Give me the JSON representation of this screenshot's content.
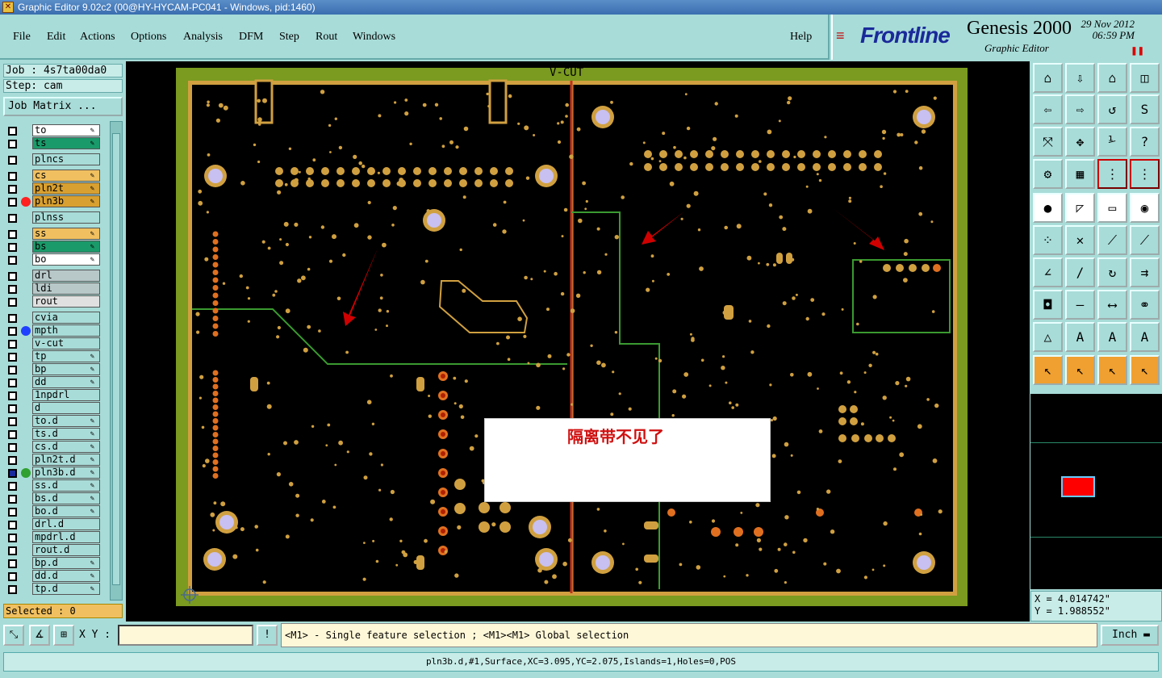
{
  "window": {
    "title": "Graphic Editor 9.02c2 (00@HY-HYCAM-PC041 - Windows, pid:1460)"
  },
  "menu": [
    "File",
    "Edit",
    "Actions",
    "Options",
    "Analysis",
    "DFM",
    "Step",
    "Rout",
    "Windows"
  ],
  "help": "Help",
  "brand": {
    "logo": "Frontline",
    "product": "Genesis 2000",
    "subtitle": "Graphic Editor",
    "date": "29 Nov 2012",
    "time": "06:59 PM"
  },
  "job": {
    "job": "Job : 4s7ta00da0",
    "step": "Step: cam",
    "matrix_button": "Job Matrix ..."
  },
  "layers": [
    {
      "name": "to",
      "color": "#ffffff",
      "edit": true
    },
    {
      "name": "ts",
      "color": "#1a9a6a",
      "edit": true
    },
    {
      "name": "plncs",
      "color": "#a8dcd8",
      "edit": false,
      "gap": true
    },
    {
      "name": "cs",
      "color": "#f0c060",
      "edit": true,
      "gap": true
    },
    {
      "name": "pln2t",
      "color": "#d8a030",
      "edit": true
    },
    {
      "name": "pln3b",
      "color": "#d8a030",
      "edit": true,
      "dot": "#ff2020"
    },
    {
      "name": "plnss",
      "color": "#a8dcd8",
      "edit": false,
      "gap": true
    },
    {
      "name": "ss",
      "color": "#f0c060",
      "edit": true,
      "gap": true
    },
    {
      "name": "bs",
      "color": "#1a9a6a",
      "edit": true
    },
    {
      "name": "bo",
      "color": "#ffffff",
      "edit": true
    },
    {
      "name": "drl",
      "color": "#b8c8c8",
      "edit": false,
      "gap": true
    },
    {
      "name": "ldi",
      "color": "#b8c8c8",
      "edit": false
    },
    {
      "name": "rout",
      "color": "#e0e0e0",
      "edit": false
    },
    {
      "name": "cvia",
      "color": "#a8dcd8",
      "edit": false,
      "gap": true
    },
    {
      "name": "mpth",
      "color": "#a8dcd8",
      "edit": false,
      "dot": "#2040ff"
    },
    {
      "name": "v-cut",
      "color": "#a8dcd8",
      "edit": false
    },
    {
      "name": "tp",
      "color": "#a8dcd8",
      "edit": true
    },
    {
      "name": "bp",
      "color": "#a8dcd8",
      "edit": true
    },
    {
      "name": "dd",
      "color": "#a8dcd8",
      "edit": true
    },
    {
      "name": "1npdrl",
      "color": "#a8dcd8",
      "edit": false
    },
    {
      "name": "d",
      "color": "#a8dcd8",
      "edit": false
    },
    {
      "name": "to.d",
      "color": "#a8dcd8",
      "edit": true
    },
    {
      "name": "ts.d",
      "color": "#a8dcd8",
      "edit": true
    },
    {
      "name": "cs.d",
      "color": "#a8dcd8",
      "edit": true
    },
    {
      "name": "pln2t.d",
      "color": "#a8dcd8",
      "edit": true
    },
    {
      "name": "pln3b.d",
      "color": "#a8dcd8",
      "edit": true,
      "dot": "#30a030",
      "active": true
    },
    {
      "name": "ss.d",
      "color": "#a8dcd8",
      "edit": true
    },
    {
      "name": "bs.d",
      "color": "#a8dcd8",
      "edit": true
    },
    {
      "name": "bo.d",
      "color": "#a8dcd8",
      "edit": true
    },
    {
      "name": "drl.d",
      "color": "#a8dcd8",
      "edit": false
    },
    {
      "name": "mpdrl.d",
      "color": "#a8dcd8",
      "edit": false
    },
    {
      "name": "rout.d",
      "color": "#a8dcd8",
      "edit": false
    },
    {
      "name": "bp.d",
      "color": "#a8dcd8",
      "edit": true
    },
    {
      "name": "dd.d",
      "color": "#a8dcd8",
      "edit": true
    },
    {
      "name": "tp.d",
      "color": "#a8dcd8",
      "edit": true
    }
  ],
  "selected": "Selected : 0",
  "canvas": {
    "vcut_label": "V-CUT",
    "note": "隔离带不见了"
  },
  "coords": {
    "x": "X = 4.014742\"",
    "y": "Y = 1.988552\""
  },
  "bottom": {
    "xy_label": "X Y :",
    "hint": "<M1> - Single feature selection ; <M1><M1> Global selection",
    "unit": "Inch"
  },
  "status": "pln3b.d,#1,Surface,XC=3.095,YC=2.075,Islands=1,Holes=0,POS"
}
